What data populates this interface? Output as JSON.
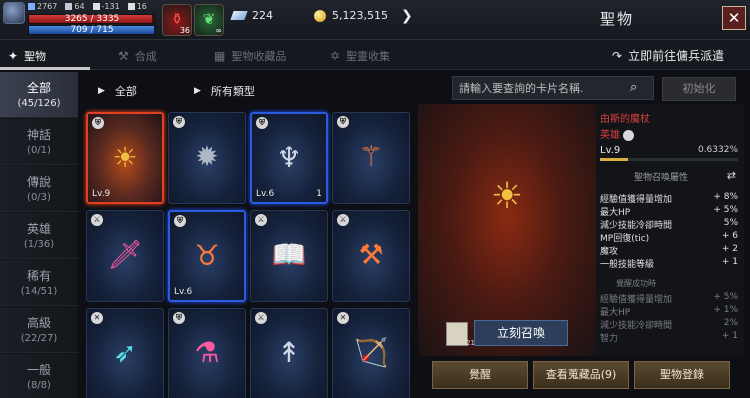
{
  "header": {
    "title": "聖物",
    "close_label": "✕",
    "player": {
      "stat_1": "2767",
      "stat_2": "64",
      "stat_3": "-131",
      "stat_4": "16",
      "hp_text": "3265 / 3335",
      "hp_fraction": 0.98,
      "mp_text": "709 / 715",
      "mp_fraction": 0.99
    },
    "quick_items": [
      {
        "name": "potion",
        "count": "36"
      },
      {
        "name": "herb",
        "count": "∞"
      }
    ],
    "currency": [
      {
        "name": "diamond",
        "value": "224"
      },
      {
        "name": "gold-coin",
        "value": "5,123,515"
      }
    ]
  },
  "tabs": [
    {
      "label": "聖物",
      "icon": "relic-icon",
      "active": true
    },
    {
      "label": "合成",
      "icon": "combine-icon",
      "active": false
    },
    {
      "label": "聖物收藏品",
      "icon": "collection-icon",
      "active": false
    },
    {
      "label": "聖靈收集",
      "icon": "star-icon",
      "active": false
    }
  ],
  "dispatch_label": "立即前往傭兵派遣",
  "categories": [
    {
      "name": "全部",
      "count": "(45/126)",
      "active": true
    },
    {
      "name": "神話",
      "count": "(0/1)",
      "active": false
    },
    {
      "name": "傳說",
      "count": "(0/3)",
      "active": false
    },
    {
      "name": "英雄",
      "count": "(1/36)",
      "active": false
    },
    {
      "name": "稀有",
      "count": "(14/51)",
      "active": false
    },
    {
      "name": "高級",
      "count": "(22/27)",
      "active": false
    },
    {
      "name": "一般",
      "count": "(8/8)",
      "active": false
    }
  ],
  "filters": {
    "grade_filter": "全部",
    "type_filter": "所有類型",
    "search_placeholder": "請輸入要查詢的卡片名稱.",
    "init_label": "初始化"
  },
  "cards": [
    {
      "icon": "sun-scepter-icon",
      "level": "Lv.9",
      "count": "",
      "frame": "red",
      "badge": "shield"
    },
    {
      "icon": "spiked-mace-icon",
      "level": "",
      "count": "",
      "frame": "none",
      "badge": "shield"
    },
    {
      "icon": "blue-trident-icon",
      "level": "Lv.6",
      "count": "1",
      "frame": "blue",
      "badge": "shield"
    },
    {
      "icon": "fire-staff-icon",
      "level": "",
      "count": "",
      "frame": "none",
      "badge": "shield"
    },
    {
      "icon": "pink-dagger-icon",
      "level": "",
      "count": "",
      "frame": "none",
      "badge": "sword"
    },
    {
      "icon": "horned-helmet-icon",
      "level": "Lv.6",
      "count": "",
      "frame": "blue",
      "badge": "shield"
    },
    {
      "icon": "spellbook-icon",
      "level": "",
      "count": "",
      "frame": "none",
      "badge": "sword"
    },
    {
      "icon": "flame-axe-icon",
      "level": "",
      "count": "",
      "frame": "none",
      "badge": "sword"
    },
    {
      "icon": "crossbow-icon",
      "level": "",
      "count": "",
      "frame": "none",
      "badge": "crossed"
    },
    {
      "icon": "potions-icon",
      "level": "",
      "count": "",
      "frame": "none",
      "badge": "shield"
    },
    {
      "icon": "spear-icon",
      "level": "",
      "count": "",
      "frame": "none",
      "badge": "sword"
    },
    {
      "icon": "bow-icon",
      "level": "",
      "count": "",
      "frame": "none",
      "badge": "crossed"
    }
  ],
  "preview": {
    "scroll_count": "21",
    "summon_label": "立刻召喚"
  },
  "detail": {
    "name": "由斯的魔杖",
    "grade": "英雄",
    "level": "Lv.9",
    "exp_percent": "0.6332%",
    "exp_fraction": 0.006332,
    "section_title": "聖物召喚屬性",
    "attributes": [
      {
        "name": "經驗值獲得量增加",
        "value": "+ 8%"
      },
      {
        "name": "最大HP",
        "value": "+ 5%"
      },
      {
        "name": "減少技能冷卻時間",
        "value": "5%"
      },
      {
        "name": "MP回復(tic)",
        "value": "+ 6"
      },
      {
        "name": "魔攻",
        "value": "+ 2"
      },
      {
        "name": "一般技能等級",
        "value": "+ 1"
      }
    ],
    "awaken_label": "覺醒成功時",
    "awaken_attributes": [
      {
        "name": "經驗值獲得量增加",
        "value": "+ 5%"
      },
      {
        "name": "最大HP",
        "value": "+ 1%"
      },
      {
        "name": "減少技能冷卻時間",
        "value": "2%"
      },
      {
        "name": "智力",
        "value": "+ 1"
      }
    ]
  },
  "buttons": {
    "awaken": "覺醒",
    "view_collection": "查看蒐藏品(9)",
    "register": "聖物登錄"
  }
}
